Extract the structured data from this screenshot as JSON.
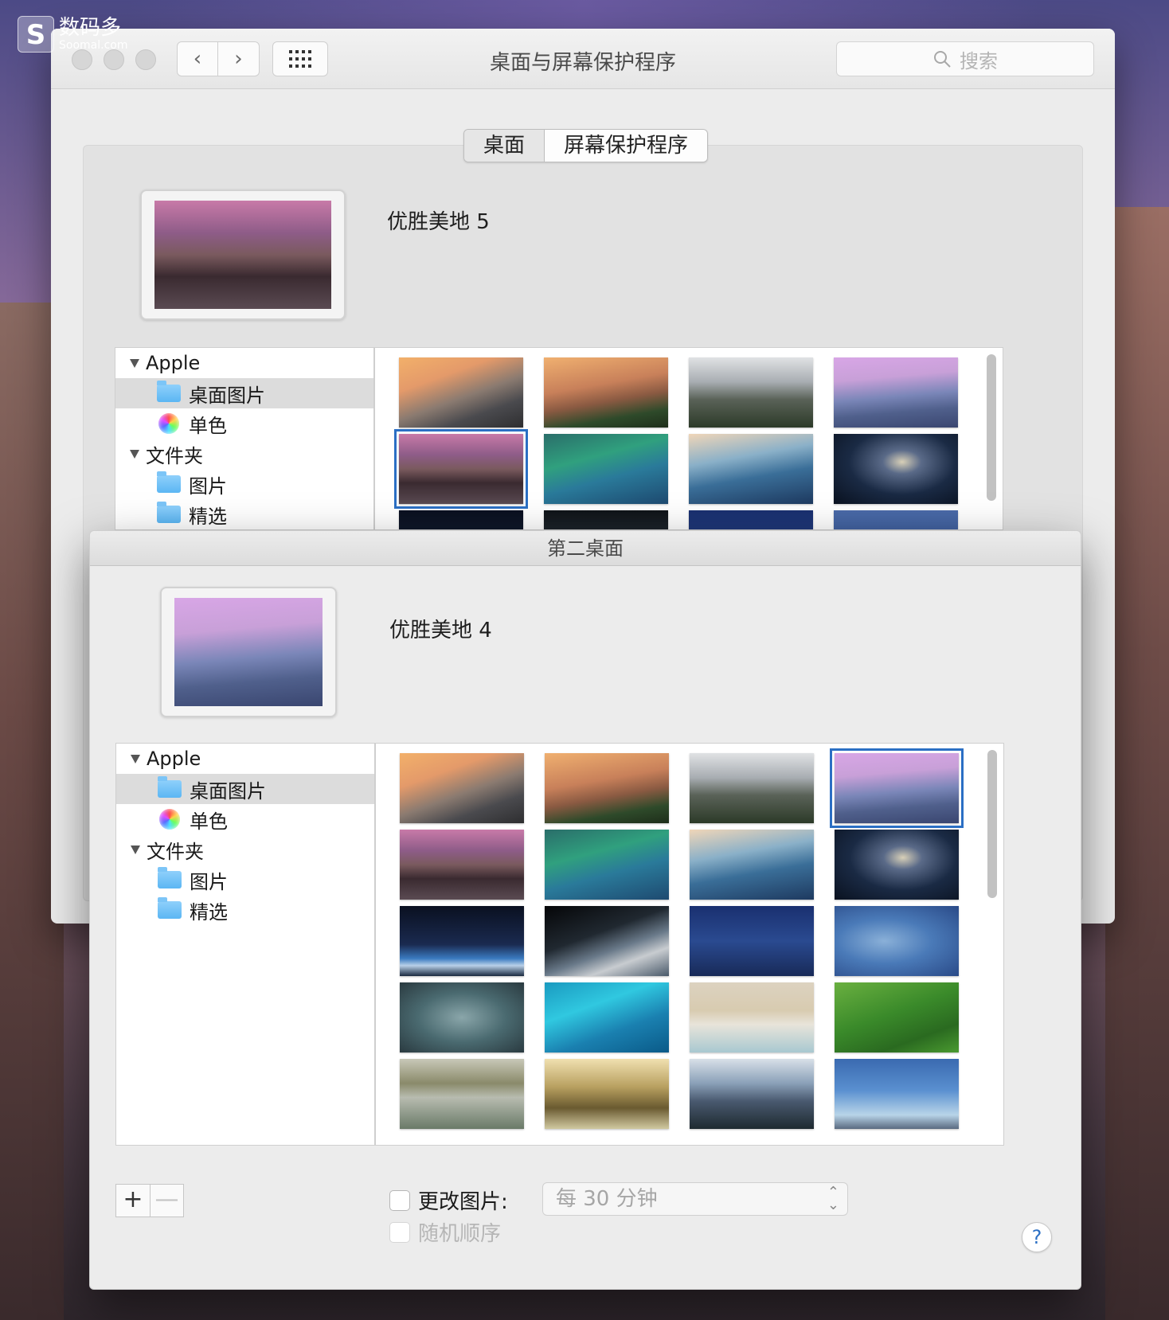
{
  "watermark": {
    "brand_cn": "数码多",
    "brand_en": "Soomal.com",
    "logo_letter": "S"
  },
  "window": {
    "title": "桌面与屏幕保护程序",
    "back_icon": "chevron-left-icon",
    "forward_icon": "chevron-right-icon",
    "grid_icon": "show-all-grid-icon",
    "search_placeholder": "搜索"
  },
  "tabs": [
    {
      "label": "桌面",
      "active": true
    },
    {
      "label": "屏幕保护程序",
      "active": false
    }
  ],
  "desktop1": {
    "wallpaper_name": "优胜美地 5",
    "source_list": [
      {
        "label": "Apple",
        "type": "group"
      },
      {
        "label": "桌面图片",
        "type": "folder",
        "selected": true
      },
      {
        "label": "单色",
        "type": "color"
      },
      {
        "label": "文件夹",
        "type": "group"
      },
      {
        "label": "图片",
        "type": "pictures-folder"
      },
      {
        "label": "精选",
        "type": "folder"
      }
    ],
    "thumbnails": [
      "wp-halfdome-sunset",
      "wp-elcap",
      "wp-misty",
      "wp-purple-halfdome",
      "wp-lake",
      "wp-wave-green",
      "wp-wave-blue",
      "wp-galaxy",
      "wp-dark-a",
      "wp-dark-b",
      "wp-dark-c",
      "wp-dark-d"
    ],
    "selected_index": 4
  },
  "desktop2": {
    "title": "第二桌面",
    "wallpaper_name": "优胜美地 4",
    "source_list": [
      {
        "label": "Apple",
        "type": "group"
      },
      {
        "label": "桌面图片",
        "type": "folder",
        "selected": true
      },
      {
        "label": "单色",
        "type": "color"
      },
      {
        "label": "文件夹",
        "type": "group"
      },
      {
        "label": "图片",
        "type": "pictures-folder"
      },
      {
        "label": "精选",
        "type": "folder"
      }
    ],
    "thumbnails": [
      "wp-halfdome-sunset",
      "wp-elcap",
      "wp-misty",
      "wp-purple-halfdome",
      "wp-lake",
      "wp-wave-green",
      "wp-wave-blue",
      "wp-galaxy",
      "wp-space-moon",
      "wp-earth",
      "wp-milkyway",
      "wp-blue-moon",
      "wp-clouds-dark",
      "wp-aqua",
      "wp-beach",
      "wp-fields",
      "wp-fog-forest",
      "wp-sunrays",
      "wp-mountains-blue",
      "wp-sky-blue"
    ],
    "selected_index": 3,
    "add_label": "+",
    "remove_label": "—",
    "change_picture_label": "更改图片:",
    "interval_value": "每 30 分钟",
    "random_order_label": "随机顺序",
    "help_label": "?"
  },
  "colors": {
    "selection": "#2b6fc4",
    "window_bg": "#ececec"
  }
}
